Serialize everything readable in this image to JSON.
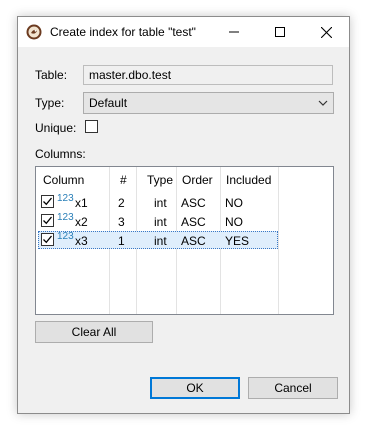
{
  "window": {
    "title": "Create index for table \"test\""
  },
  "form": {
    "table_label": "Table:",
    "table_value": "master.dbo.test",
    "type_label": "Type:",
    "type_value": "Default",
    "unique_label": "Unique:",
    "unique_checked": false,
    "columns_label": "Columns:"
  },
  "columns_list": {
    "headers": [
      "Column",
      "#",
      "Type",
      "Order",
      "Included"
    ],
    "rows": [
      {
        "checked": true,
        "icon": "123",
        "name": "x1",
        "index": "2",
        "type": "int",
        "order": "ASC",
        "included": "NO"
      },
      {
        "checked": true,
        "icon": "123",
        "name": "x2",
        "index": "3",
        "type": "int",
        "order": "ASC",
        "included": "NO"
      },
      {
        "checked": true,
        "icon": "123",
        "name": "x3",
        "index": "1",
        "type": "int",
        "order": "ASC",
        "included": "YES",
        "selected": true
      }
    ]
  },
  "buttons": {
    "clear_all": "Clear All",
    "ok": "OK",
    "cancel": "Cancel"
  },
  "colors": {
    "selection": "#dfeefc",
    "focus_border": "#0078d7",
    "icon_blue": "#2a7fb8"
  }
}
